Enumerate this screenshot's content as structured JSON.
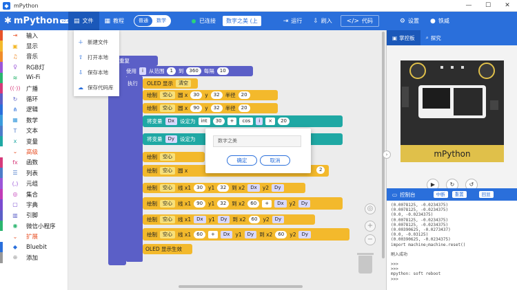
{
  "window": {
    "title": "mPython",
    "controls": [
      "—",
      "☐",
      "✕"
    ]
  },
  "menubar": {
    "logo": "mPython",
    "version": "v2.x",
    "file": "文件",
    "tutorial": "教程",
    "mode_normal": "普通",
    "mode_math": "数学",
    "connection": "已连接",
    "filename": "数字之美 (上",
    "run": "运行",
    "flash": "刷入",
    "code": "代码",
    "settings": "设置",
    "user": "铁威"
  },
  "file_menu": [
    "新建文件",
    "打开本地",
    "保存本地",
    "保存代码库"
  ],
  "sidebar": {
    "items": [
      {
        "label": "输入",
        "icon": "⇥",
        "color": "#e8542a"
      },
      {
        "label": "显示",
        "icon": "▣",
        "color": "#f3b92c"
      },
      {
        "label": "音乐",
        "icon": "♫",
        "color": "#f08c2a"
      },
      {
        "label": "RGB灯",
        "icon": "♀",
        "color": "#9b56d8"
      },
      {
        "label": "Wi-Fi",
        "icon": "≋",
        "color": "#2bb56f"
      },
      {
        "label": "广播",
        "icon": "((·))",
        "color": "#d63a7a"
      },
      {
        "label": "循环",
        "icon": "↻",
        "color": "#5b5fc7"
      },
      {
        "label": "逻辑",
        "icon": "⋔",
        "color": "#2a6fdb"
      },
      {
        "label": "数学",
        "icon": "▦",
        "color": "#3a9bdc"
      },
      {
        "label": "文本",
        "icon": "T",
        "color": "#4d7cc9"
      },
      {
        "label": "变量",
        "icon": "x",
        "color": "#1fa8a4"
      },
      {
        "label": "高级",
        "icon": "⌄",
        "color": "",
        "section": true
      },
      {
        "label": "函数",
        "icon": "fx",
        "color": "#d63a7a"
      },
      {
        "label": "列表",
        "icon": "☰",
        "color": "#4d7cc9"
      },
      {
        "label": "元组",
        "icon": "(,)",
        "color": "#9b56d8"
      },
      {
        "label": "集合",
        "icon": "◎",
        "color": "#c13bb7"
      },
      {
        "label": "字典",
        "icon": "▢",
        "color": "#7a4bd0"
      },
      {
        "label": "引脚",
        "icon": "▥",
        "color": "#5b5fc7"
      },
      {
        "label": "微信小程序",
        "icon": "◉",
        "color": "#2bb56f"
      },
      {
        "label": "扩展",
        "icon": "⌄",
        "color": "",
        "section": true
      },
      {
        "label": "Bluebit",
        "icon": "◆",
        "color": "#2a6fdb"
      },
      {
        "label": "添加",
        "icon": "⊕",
        "color": "#999999"
      }
    ]
  },
  "blocks": {
    "repeat": "重复",
    "use": "使用",
    "range_from": "从范围",
    "to": "到",
    "step": "每隔",
    "exec": "执行",
    "oled": "OLED 显示",
    "clear": "清空",
    "draw": "绘制",
    "hollow": "空心",
    "circle": "圆 x",
    "y": "y",
    "radius": "半径",
    "line": "线 x1",
    "y1": "y1",
    "to_x2": "到 x2",
    "y2": "y2",
    "set_var": "将变量",
    "set_to": "设定为",
    "int": "int",
    "var_i": "i",
    "var_dx": "Dx",
    "var_dy": "Dy",
    "cos": "cos",
    "show_effect": "OLED 显示生效",
    "values": {
      "one": "1",
      "three_sixty": "360",
      "ten": "10",
      "thirty": "30",
      "thirty_two": "32",
      "twenty": "20",
      "ninety": "90",
      "sixty": "60",
      "two": "2",
      "plus": "+",
      "times": "×"
    }
  },
  "dialog": {
    "value": "数字之美",
    "ok": "确定",
    "cancel": "取消"
  },
  "right_tabs": {
    "board": "掌控板",
    "explore": "探究"
  },
  "console": {
    "title": "控制台",
    "interrupt": "中断",
    "reset": "重置",
    "toggle": "回显",
    "lines": [
      "(0.0078125, -0.0234375)",
      "(0.0078125, -0.0234375)",
      "(0.0, -0.0234375)",
      "(0.0078125, -0.0234375)",
      "(0.0078125, -0.0234375)",
      "(0.00390625, -0.0273437)",
      "(0.0, -0.03125)",
      "(0.00390625, -0.0234375)",
      "import machine;machine.reset()",
      "",
      "刷入成功",
      "",
      ">>>",
      ">>>",
      "mpython: soft reboot",
      ">>>"
    ]
  },
  "colors": {
    "primary": "#2a6fdb",
    "yellow_block": "#f3b92c",
    "purple_block": "#5b5fc7",
    "teal_block": "#1fa8a4"
  }
}
